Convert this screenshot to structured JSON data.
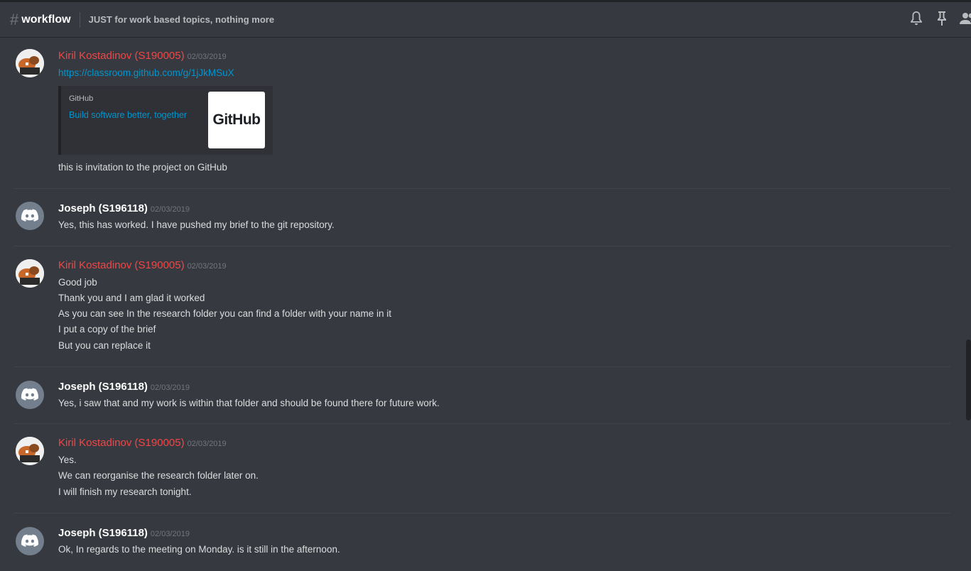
{
  "header": {
    "channel_name": "workflow",
    "topic": "JUST for work based topics, nothing more"
  },
  "messages": [
    {
      "author": "Kiril Kostadinov (S190005)",
      "timestamp": "02/03/2019",
      "lines": [
        "this is invitation to the project on GitHub"
      ],
      "link": "https://classroom.github.com/g/1jJkMSuX",
      "embed": {
        "provider": "GitHub",
        "title": "Build software better, together",
        "thumbnail_text": "GitHub"
      }
    },
    {
      "author": "Joseph (S196118)",
      "timestamp": "02/03/2019",
      "lines": [
        "Yes, this has worked. I have pushed my brief to the git repository."
      ]
    },
    {
      "author": "Kiril Kostadinov (S190005)",
      "timestamp": "02/03/2019",
      "lines": [
        "Good job",
        "Thank you and I am glad it worked",
        "As you can see In the research folder you can find a folder with your name in it",
        "I put a copy of the brief",
        "But you can replace it"
      ]
    },
    {
      "author": "Joseph (S196118)",
      "timestamp": "02/03/2019",
      "lines": [
        "Yes, i saw that and my work is within that folder and should be found there for future work."
      ]
    },
    {
      "author": "Kiril Kostadinov (S190005)",
      "timestamp": "02/03/2019",
      "lines": [
        "Yes.",
        "We can reorganise the research folder later on.",
        "I will finish my research tonight."
      ]
    },
    {
      "author": "Joseph (S196118)",
      "timestamp": "02/03/2019",
      "lines": [
        "Ok, In regards to the meeting on Monday. is it still in the afternoon."
      ]
    }
  ],
  "colors": {
    "background": "#36393f",
    "author_red": "#f04747",
    "link": "#0096cf"
  }
}
